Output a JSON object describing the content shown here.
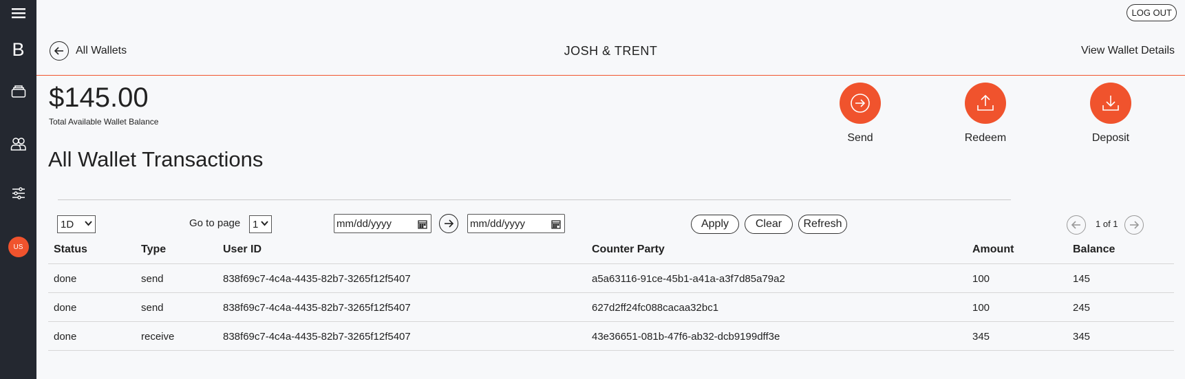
{
  "sidebar": {
    "logo_letter": "B",
    "avatar_initials": "US"
  },
  "topbar": {
    "logout_label": "LOG OUT"
  },
  "header": {
    "back_label": "All Wallets",
    "wallet_name": "JOSH & TRENT",
    "view_details_label": "View Wallet Details"
  },
  "wallet": {
    "balance": "$145.00",
    "balance_caption": "Total Available Wallet Balance"
  },
  "actions": [
    {
      "label": "Send",
      "icon": "arrow-right-circle-icon"
    },
    {
      "label": "Redeem",
      "icon": "upload-icon"
    },
    {
      "label": "Deposit",
      "icon": "download-icon"
    }
  ],
  "transactions": {
    "title": "All Wallet Transactions",
    "period_value": "1D",
    "goto_label": "Go to page",
    "page_value": "1",
    "date_from_placeholder": "mm/dd/yyyy",
    "date_to_placeholder": "mm/dd/yyyy",
    "apply_label": "Apply",
    "clear_label": "Clear",
    "refresh_label": "Refresh",
    "pagination": "1 of 1",
    "columns": [
      "Status",
      "Type",
      "User ID",
      "Counter Party",
      "Amount",
      "Balance"
    ],
    "rows": [
      [
        "done",
        "send",
        "838f69c7-4c4a-4435-82b7-3265f12f5407",
        "a5a63116-91ce-45b1-a41a-a3f7d85a79a2",
        "100",
        "145"
      ],
      [
        "done",
        "send",
        "838f69c7-4c4a-4435-82b7-3265f12f5407",
        "627d2ff24fc088cacaa32bc1",
        "100",
        "245"
      ],
      [
        "done",
        "receive",
        "838f69c7-4c4a-4435-82b7-3265f12f5407",
        "43e36651-081b-47f6-ab32-dcb9199dff3e",
        "345",
        "345"
      ]
    ]
  },
  "colors": {
    "accent": "#f0532d",
    "sidebar_bg": "#242830",
    "page_bg": "#f7f8fa"
  }
}
